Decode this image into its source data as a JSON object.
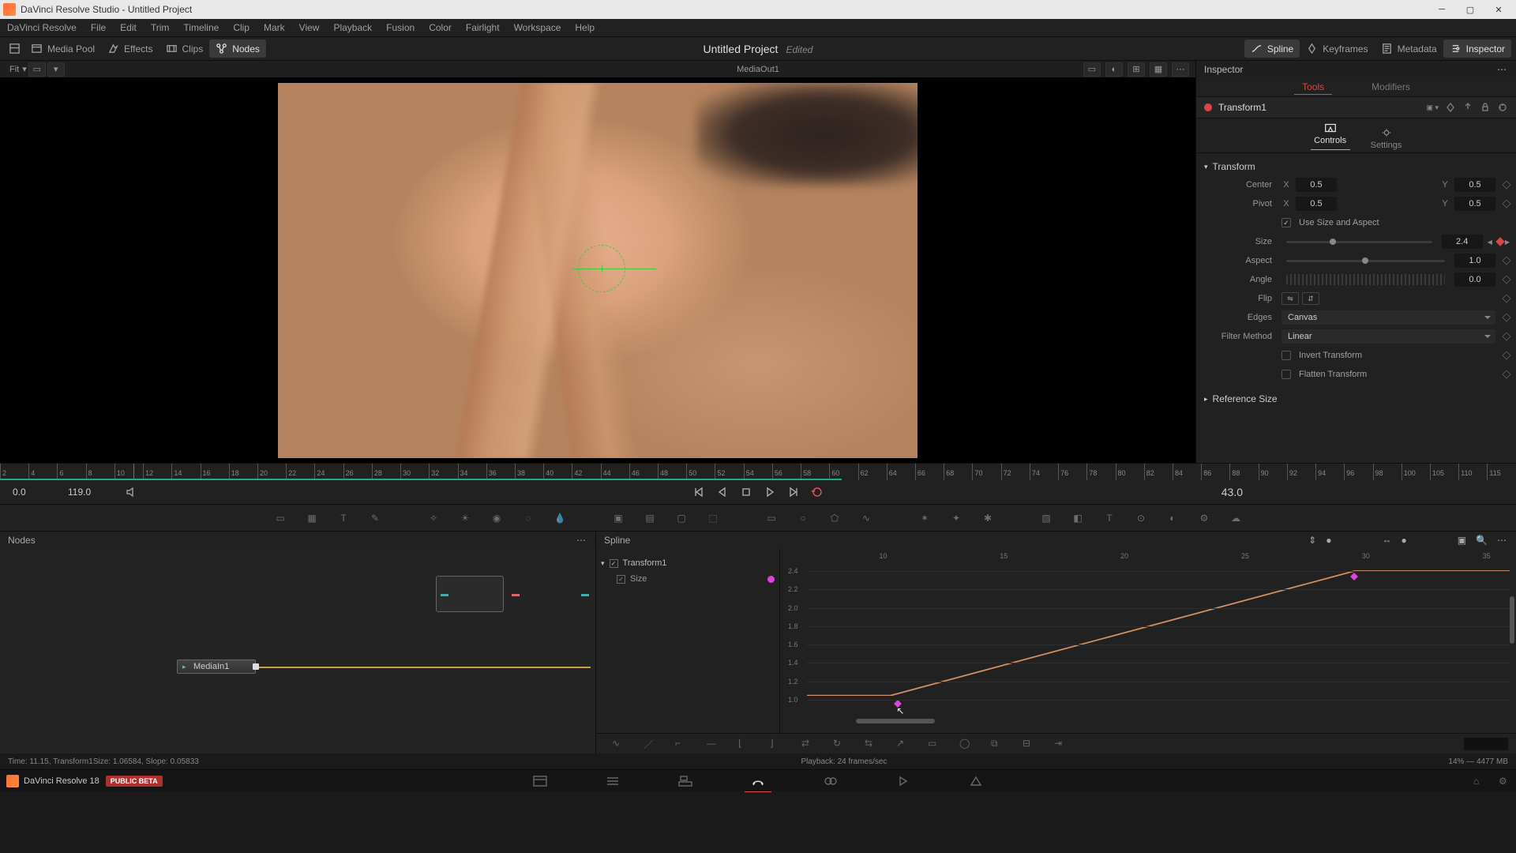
{
  "app_title": "DaVinci Resolve Studio - Untitled Project",
  "menus": [
    "DaVinci Resolve",
    "File",
    "Edit",
    "Trim",
    "Timeline",
    "Clip",
    "Mark",
    "View",
    "Playback",
    "Fusion",
    "Color",
    "Fairlight",
    "Workspace",
    "Help"
  ],
  "toolbar": {
    "media_pool": "Media Pool",
    "effects": "Effects",
    "clips": "Clips",
    "nodes": "Nodes",
    "spline": "Spline",
    "keyframes": "Keyframes",
    "metadata": "Metadata",
    "inspector": "Inspector",
    "project": "Untitled Project",
    "edited": "Edited"
  },
  "viewer": {
    "fit": "Fit",
    "fit_chevron": "▾",
    "media_out": "MediaOut1"
  },
  "ruler": {
    "ticks": [
      "2",
      "4",
      "6",
      "8",
      "10",
      "12",
      "14",
      "16",
      "18",
      "20",
      "22",
      "24",
      "26",
      "28",
      "30",
      "32",
      "34",
      "36",
      "38",
      "40",
      "42",
      "44",
      "46",
      "48",
      "50",
      "52",
      "54",
      "56",
      "58",
      "60",
      "62",
      "64",
      "66",
      "68",
      "70",
      "72",
      "74",
      "76",
      "78",
      "80",
      "82",
      "84",
      "86",
      "88",
      "90",
      "92",
      "94",
      "96",
      "98",
      "100",
      "105",
      "110",
      "115"
    ],
    "green_end_pct": 55.5,
    "playhead_pct": 8.8
  },
  "transport": {
    "range_lo": "0.0",
    "range_hi": "119.0",
    "current": "43.0"
  },
  "nodes_panel": {
    "title": "Nodes",
    "media_in": "MediaIn1"
  },
  "spline_panel": {
    "title": "Spline",
    "tree": {
      "transform": "Transform1",
      "size": "Size"
    },
    "x_ticks": [
      "10",
      "15",
      "20",
      "25",
      "30",
      "35"
    ],
    "y_ticks": [
      "2.4",
      "2.2",
      "2.0",
      "1.8",
      "1.6",
      "1.4",
      "1.2",
      "1.0"
    ]
  },
  "inspector": {
    "header": "Inspector",
    "tabs": {
      "tools": "Tools",
      "modifiers": "Modifiers"
    },
    "node_name": "Transform1",
    "subtabs": {
      "controls": "Controls",
      "settings": "Settings"
    },
    "section": "Transform",
    "params": {
      "center_label": "Center",
      "center_x": "0.5",
      "center_y": "0.5",
      "pivot_label": "Pivot",
      "pivot_x": "0.5",
      "pivot_y": "0.5",
      "use_size_aspect": "Use Size and Aspect",
      "size_label": "Size",
      "size": "2.4",
      "aspect_label": "Aspect",
      "aspect": "1.0",
      "angle_label": "Angle",
      "angle": "0.0",
      "flip_label": "Flip",
      "edges_label": "Edges",
      "edges": "Canvas",
      "filter_label": "Filter Method",
      "filter": "Linear",
      "invert": "Invert Transform",
      "flatten": "Flatten Transform",
      "axis_x": "X",
      "axis_y": "Y"
    },
    "ref_size": "Reference Size"
  },
  "status": {
    "left": "Time: 11.15,   Transform1Size:   1.06584,   Slope: 0.05833",
    "center": "Playback: 24 frames/sec",
    "right": "14% — 4477 MB"
  },
  "footer": {
    "brand": "DaVinci Resolve 18",
    "beta": "PUBLIC BETA"
  }
}
